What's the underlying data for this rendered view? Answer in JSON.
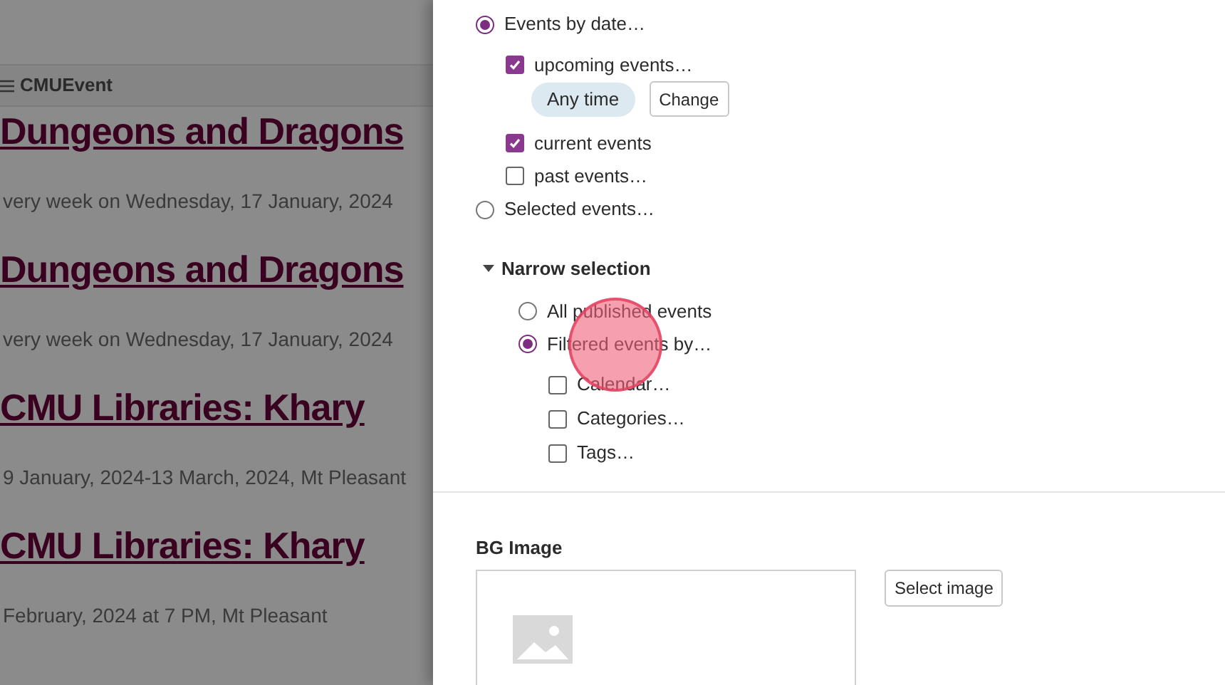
{
  "background_page": {
    "site_title": "CMUEvent",
    "events": [
      {
        "title": "Dungeons and Dragons",
        "date": "very week on Wednesday, 17 January, 2024"
      },
      {
        "title": "Dungeons and Dragons",
        "date": "very week on Wednesday, 17 January, 2024"
      },
      {
        "title": "CMU Libraries: Khary",
        "date": "9 January, 2024-13 March, 2024, Mt Pleasant"
      },
      {
        "title": "CMU Libraries: Khary",
        "date": "February, 2024 at 7 PM, Mt Pleasant"
      }
    ]
  },
  "event_source": [
    {
      "label": "Events by date…",
      "selected": true,
      "options": [
        {
          "label": "upcoming events…",
          "checked": true,
          "range": {
            "label": "Any time",
            "button": "Change"
          }
        },
        {
          "label": "current events",
          "checked": true
        },
        {
          "label": "past events…",
          "checked": false
        }
      ]
    },
    {
      "label": "Selected events…",
      "selected": false
    }
  ],
  "narrow_selection": {
    "title": "Narrow selection",
    "expanded": true,
    "options": [
      {
        "label": "All published events",
        "selected": false
      },
      {
        "label": "Filtered events by…",
        "selected": true,
        "filters": [
          {
            "label": "Calendar…",
            "checked": false
          },
          {
            "label": "Categories…",
            "checked": false
          },
          {
            "label": "Tags…",
            "checked": false
          }
        ]
      }
    ]
  },
  "bg_image": {
    "label": "BG Image",
    "button": "Select image"
  }
}
